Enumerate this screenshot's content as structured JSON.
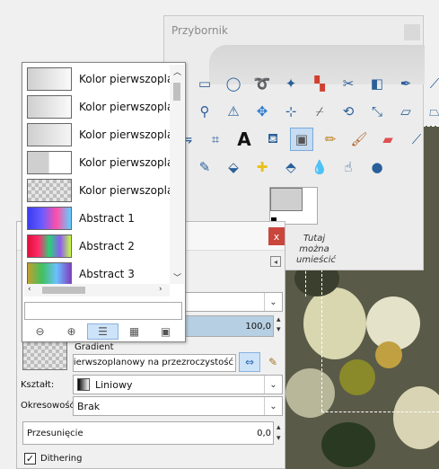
{
  "toolbox": {
    "title": "Przybornik",
    "hint": "Tutaj można umieścić",
    "colors": {
      "foreground": "#cfcfcf",
      "background": "#ffffff"
    },
    "tools": [
      "rect-select-icon",
      "ellipse-select-icon",
      "lasso-icon",
      "fuzzy-select-icon",
      "color-select-icon",
      "scissors-icon",
      "foreground-select-icon",
      "paths-icon",
      "color-picker-icon",
      "zoom-icon",
      "measure-icon",
      "move-icon",
      "align-icon",
      "crop-icon",
      "rotate-icon",
      "scale-icon",
      "shear-icon",
      "perspective-icon",
      "flip-icon",
      "cage-icon",
      "text-icon",
      "bucket-fill-icon",
      "blend-icon",
      "pencil-icon",
      "paintbrush-icon",
      "eraser-icon",
      "airbrush-icon",
      "ink-icon",
      "clone-icon",
      "heal-icon",
      "perspective-clone-icon",
      "blur-icon",
      "smudge-icon",
      "dodge-burn-icon"
    ]
  },
  "gradient_list": {
    "items": [
      {
        "name": "Kolor pierwszoplanowy na tło (RGB)",
        "swatch": "linear-gradient(90deg,#cfcfcf,#fafafa)"
      },
      {
        "name": "Kolor pierwszoplanowy na tło (HSV)",
        "swatch": "linear-gradient(90deg,#cfcfcf,#fafafa)"
      },
      {
        "name": "Kolor pierwszoplanowy na tło (twardy)",
        "swatch": "linear-gradient(90deg,#cfcfcf,#f5f5f5)"
      },
      {
        "name": "Kolor pierwszoplanowy na tło (ostre)",
        "swatch": "linear-gradient(90deg,#cfcfcf 0%,#cfcfcf 48%,#ffffff 50%,#ffffff 100%)"
      },
      {
        "name": "Kolor pierwszoplanowy na przezroczystość",
        "swatch": "repeating-conic-gradient(#bdbdbd 0% 25%,#e6e6e6 0% 50%) 0 0/8px 8px"
      },
      {
        "name": "Abstract 1",
        "swatch": "linear-gradient(90deg,#3a3cf0,#6a5cff,#ff4fa8,#5fd0ff)"
      },
      {
        "name": "Abstract 2",
        "swatch": "linear-gradient(90deg,#e0103a,#ff2b6a,#2ad07a,#8d5cf0,#c8ff40)"
      },
      {
        "name": "Abstract 3",
        "swatch": "linear-gradient(90deg,#c0a030,#40c060,#6ac0ff,#8040c0)"
      }
    ]
  },
  "options": {
    "opacity_value": "100,0",
    "gradient_label": "Gradient",
    "gradient_name": "Kolor pierwszoplanowy na przezroczystość",
    "shape_label": "Kształt:",
    "shape_value": "Liniowy",
    "repeat_label": "Okresowość:",
    "repeat_value": "Brak",
    "offset_label": "Przesunięcie",
    "offset_value": "0,0",
    "dithering_label": "Dithering",
    "close_label": "x"
  }
}
